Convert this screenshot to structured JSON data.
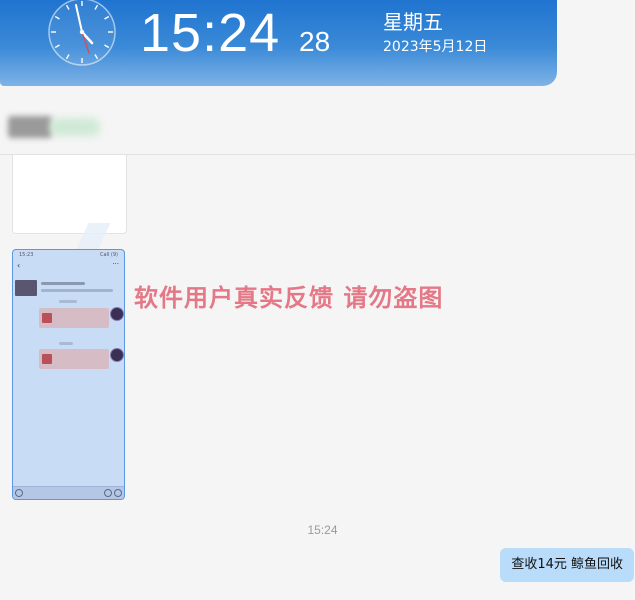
{
  "clock": {
    "time": "15:24",
    "seconds": "28",
    "weekday": "星期五",
    "date": "2023年5月12日"
  },
  "screenshot_card": {
    "status_left": "15:23",
    "status_right": "Call (9)",
    "back_glyph": "‹",
    "more_glyph": "···"
  },
  "watermark": "软件用户真实反馈  请勿盗图",
  "timestamp": "15:24",
  "message": {
    "text": "查收14元   鲸鱼回收"
  },
  "colors": {
    "banner_top": "#1f74cf",
    "bubble_right": "#b8dcfa",
    "watermark": "#e46b7a"
  },
  "icons": [
    "analog-clock-icon",
    "back-arrow-icon",
    "more-icon",
    "voice-icon",
    "emoji-icon",
    "plus-icon"
  ]
}
